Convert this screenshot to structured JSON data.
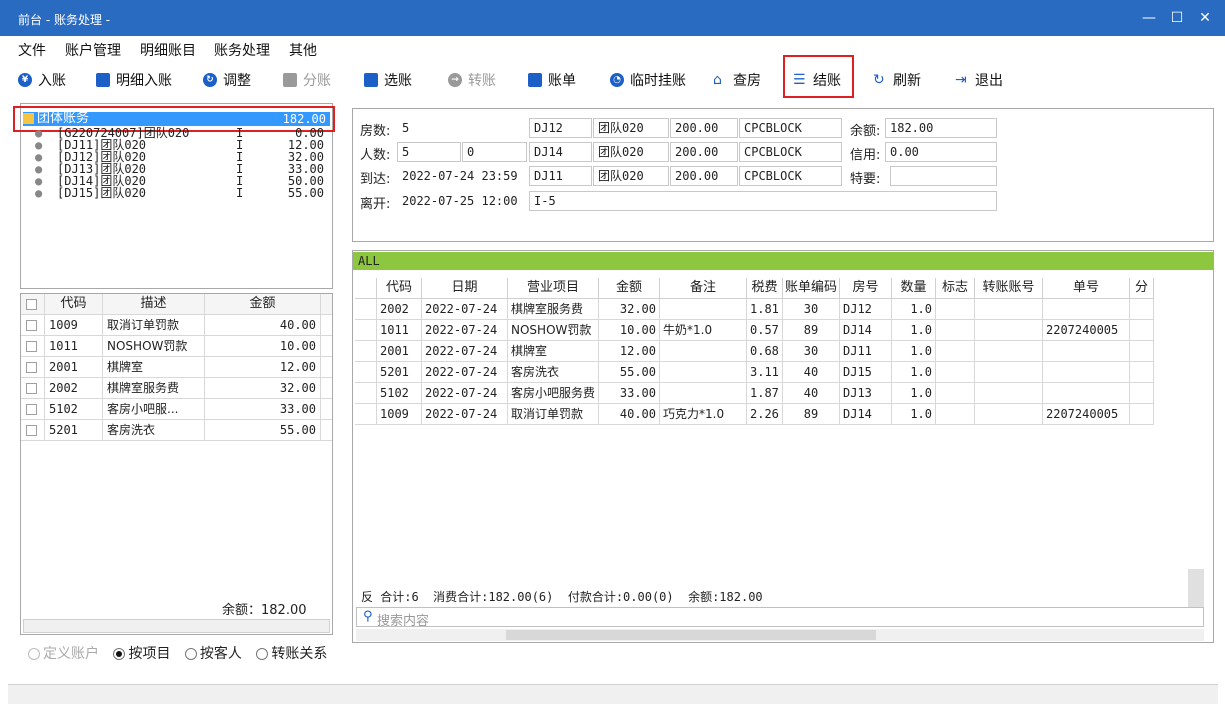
{
  "window": {
    "title": "前台 - 账务处理 -",
    "btn_min": "—",
    "btn_max": "☐",
    "btn_close": "✕"
  },
  "menu": [
    "文件",
    "账户管理",
    "明细账目",
    "账务处理",
    "其他"
  ],
  "toolbar": [
    {
      "label": "入账",
      "icon": "yen-circle-icon",
      "enabled": true
    },
    {
      "label": "明细入账",
      "icon": "list-icon",
      "enabled": true
    },
    {
      "label": "调整",
      "icon": "adjust-icon",
      "enabled": true
    },
    {
      "label": "分账",
      "icon": "split-icon",
      "enabled": false
    },
    {
      "label": "选账",
      "icon": "select-icon",
      "enabled": true
    },
    {
      "label": "转账",
      "icon": "transfer-icon",
      "enabled": false
    },
    {
      "label": "账单",
      "icon": "bill-icon",
      "enabled": true
    },
    {
      "label": "临时挂账",
      "icon": "clock-icon",
      "enabled": true
    },
    {
      "label": "查房",
      "icon": "house-icon",
      "enabled": true
    },
    {
      "label": "结账",
      "icon": "database-icon",
      "enabled": true,
      "highlighted": true
    },
    {
      "label": "刷新",
      "icon": "refresh-icon",
      "enabled": true
    },
    {
      "label": "退出",
      "icon": "exit-icon",
      "enabled": true
    }
  ],
  "tree": {
    "root": {
      "label": "团体账务",
      "amount": "182.00"
    },
    "children": [
      {
        "label": "[G220724007]团队020",
        "flag": "I",
        "amount": "0.00"
      },
      {
        "label": "[DJ11]团队020",
        "flag": "I",
        "amount": "12.00"
      },
      {
        "label": "[DJ12]团队020",
        "flag": "I",
        "amount": "32.00"
      },
      {
        "label": "[DJ13]团队020",
        "flag": "I",
        "amount": "33.00"
      },
      {
        "label": "[DJ14]团队020",
        "flag": "I",
        "amount": "50.00"
      },
      {
        "label": "[DJ15]团队020",
        "flag": "I",
        "amount": "55.00"
      }
    ]
  },
  "left_table": {
    "headers": [
      "代码",
      "描述",
      "金额"
    ],
    "rows": [
      {
        "code": "1009",
        "desc": "取消订单罚款",
        "amount": "40.00"
      },
      {
        "code": "1011",
        "desc": "NOSHOW罚款",
        "amount": "10.00"
      },
      {
        "code": "2001",
        "desc": "棋牌室",
        "amount": "12.00"
      },
      {
        "code": "2002",
        "desc": "棋牌室服务费",
        "amount": "32.00"
      },
      {
        "code": "5102",
        "desc": "客房小吧服...",
        "amount": "33.00"
      },
      {
        "code": "5201",
        "desc": "客房洗衣",
        "amount": "55.00"
      }
    ],
    "balance_label": "余额：182.00"
  },
  "radios": [
    {
      "label": "定义账户",
      "checked": false,
      "enabled": false
    },
    {
      "label": "按项目",
      "checked": true,
      "enabled": true
    },
    {
      "label": "按客人",
      "checked": false,
      "enabled": true
    },
    {
      "label": "转账关系",
      "checked": false,
      "enabled": true
    }
  ],
  "info": {
    "rooms_label": "房数:",
    "rooms_value": "5",
    "people_label": "人数:",
    "people_value": "5",
    "people_value2": "0",
    "arrive_label": "到达:",
    "arrive_value": "2022-07-24 23:59",
    "depart_label": "离开:",
    "depart_value": "2022-07-25 12:00",
    "room_rows": [
      {
        "room": "DJ12",
        "group": "团队020",
        "price": "200.00",
        "code": "CPCBLOCK"
      },
      {
        "room": "DJ14",
        "group": "团队020",
        "price": "200.00",
        "code": "CPCBLOCK"
      },
      {
        "room": "DJ11",
        "group": "团队020",
        "price": "200.00",
        "code": "CPCBLOCK"
      }
    ],
    "extra": "I-5",
    "balance_label": "余额:",
    "balance_value": "182.00",
    "credit_label": "信用:",
    "credit_value": "0.00",
    "special_label": "特要:",
    "special_value": ""
  },
  "grid": {
    "tab_label": "ALL",
    "headers": [
      "代码",
      "日期",
      "营业项目",
      "金额",
      "备注",
      "税费",
      "账单编码",
      "房号",
      "数量",
      "标志",
      "转账账号",
      "单号",
      "分"
    ],
    "rows": [
      {
        "code": "2002",
        "date": "2022-07-24",
        "item": "棋牌室服务费",
        "amount": "32.00",
        "note": "",
        "tax": "1.81",
        "bill": "30",
        "room": "DJ12",
        "qty": "1.0",
        "flag": "",
        "transfer": "",
        "no": ""
      },
      {
        "code": "1011",
        "date": "2022-07-24",
        "item": "NOSHOW罚款",
        "amount": "10.00",
        "note": "牛奶*1.0",
        "tax": "0.57",
        "bill": "89",
        "room": "DJ14",
        "qty": "1.0",
        "flag": "",
        "transfer": "",
        "no": "2207240005"
      },
      {
        "code": "2001",
        "date": "2022-07-24",
        "item": "棋牌室",
        "amount": "12.00",
        "note": "",
        "tax": "0.68",
        "bill": "30",
        "room": "DJ11",
        "qty": "1.0",
        "flag": "",
        "transfer": "",
        "no": ""
      },
      {
        "code": "5201",
        "date": "2022-07-24",
        "item": "客房洗衣",
        "amount": "55.00",
        "note": "",
        "tax": "3.11",
        "bill": "40",
        "room": "DJ15",
        "qty": "1.0",
        "flag": "",
        "transfer": "",
        "no": ""
      },
      {
        "code": "5102",
        "date": "2022-07-24",
        "item": "客房小吧服务费",
        "amount": "33.00",
        "note": "",
        "tax": "1.87",
        "bill": "40",
        "room": "DJ13",
        "qty": "1.0",
        "flag": "",
        "transfer": "",
        "no": ""
      },
      {
        "code": "1009",
        "date": "2022-07-24",
        "item": "取消订单罚款",
        "amount": "40.00",
        "note": "巧克力*1.0",
        "tax": "2.26",
        "bill": "89",
        "room": "DJ14",
        "qty": "1.0",
        "flag": "",
        "transfer": "",
        "no": "2207240005"
      }
    ],
    "footer": "反 合计:6  消费合计:182.00(6)  付款合计:0.00(0)  余额:182.00",
    "search_placeholder": "搜索内容"
  },
  "colors": {
    "titlebar": "#2a6bc2",
    "accent": "#1b5fc7",
    "highlight": "#e02020",
    "tab_bar": "#8dc63f",
    "selected": "#3399ff"
  }
}
